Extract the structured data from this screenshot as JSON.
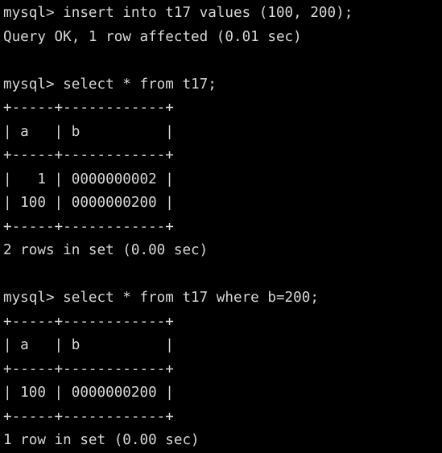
{
  "terminal": {
    "background_color": "#000000",
    "text_color": "#d8d8d8",
    "prompt": "mysql>",
    "lines": [
      {
        "id": "line-1",
        "text": "mysql> insert into t17 values (100, 200);"
      },
      {
        "id": "line-2",
        "text": "Query OK, 1 row affected (0.01 sec)"
      },
      {
        "id": "line-3",
        "text": ""
      },
      {
        "id": "line-4",
        "text": "mysql> select * from t17;"
      },
      {
        "id": "line-5",
        "text": "+-----+------------+"
      },
      {
        "id": "line-6",
        "text": "| a   | b          |"
      },
      {
        "id": "line-7",
        "text": "+-----+------------+"
      },
      {
        "id": "line-8",
        "text": "|   1 | 0000000002 |"
      },
      {
        "id": "line-9",
        "text": "| 100 | 0000000200 |"
      },
      {
        "id": "line-10",
        "text": "+-----+------------+"
      },
      {
        "id": "line-11",
        "text": "2 rows in set (0.00 sec)"
      },
      {
        "id": "line-12",
        "text": ""
      },
      {
        "id": "line-13",
        "text": "mysql> select * from t17 where b=200;"
      },
      {
        "id": "line-14",
        "text": "+-----+------------+"
      },
      {
        "id": "line-15",
        "text": "| a   | b          |"
      },
      {
        "id": "line-16",
        "text": "+-----+------------+"
      },
      {
        "id": "line-17",
        "text": "| 100 | 0000000200 |"
      },
      {
        "id": "line-18",
        "text": "+-----+------------+"
      },
      {
        "id": "line-19",
        "text": "1 row in set (0.00 sec)"
      }
    ],
    "statements": [
      {
        "query": "insert into t17 values (100, 200);",
        "result_status": "Query OK, 1 row affected (0.01 sec)"
      },
      {
        "query": "select * from t17;",
        "columns": [
          "a",
          "b"
        ],
        "rows": [
          {
            "a": "1",
            "b": "0000000002"
          },
          {
            "a": "100",
            "b": "0000000200"
          }
        ],
        "result_status": "2 rows in set (0.00 sec)"
      },
      {
        "query": "select * from t17 where b=200;",
        "columns": [
          "a",
          "b"
        ],
        "rows": [
          {
            "a": "100",
            "b": "0000000200"
          }
        ],
        "result_status": "1 row in set (0.00 sec)"
      }
    ]
  }
}
